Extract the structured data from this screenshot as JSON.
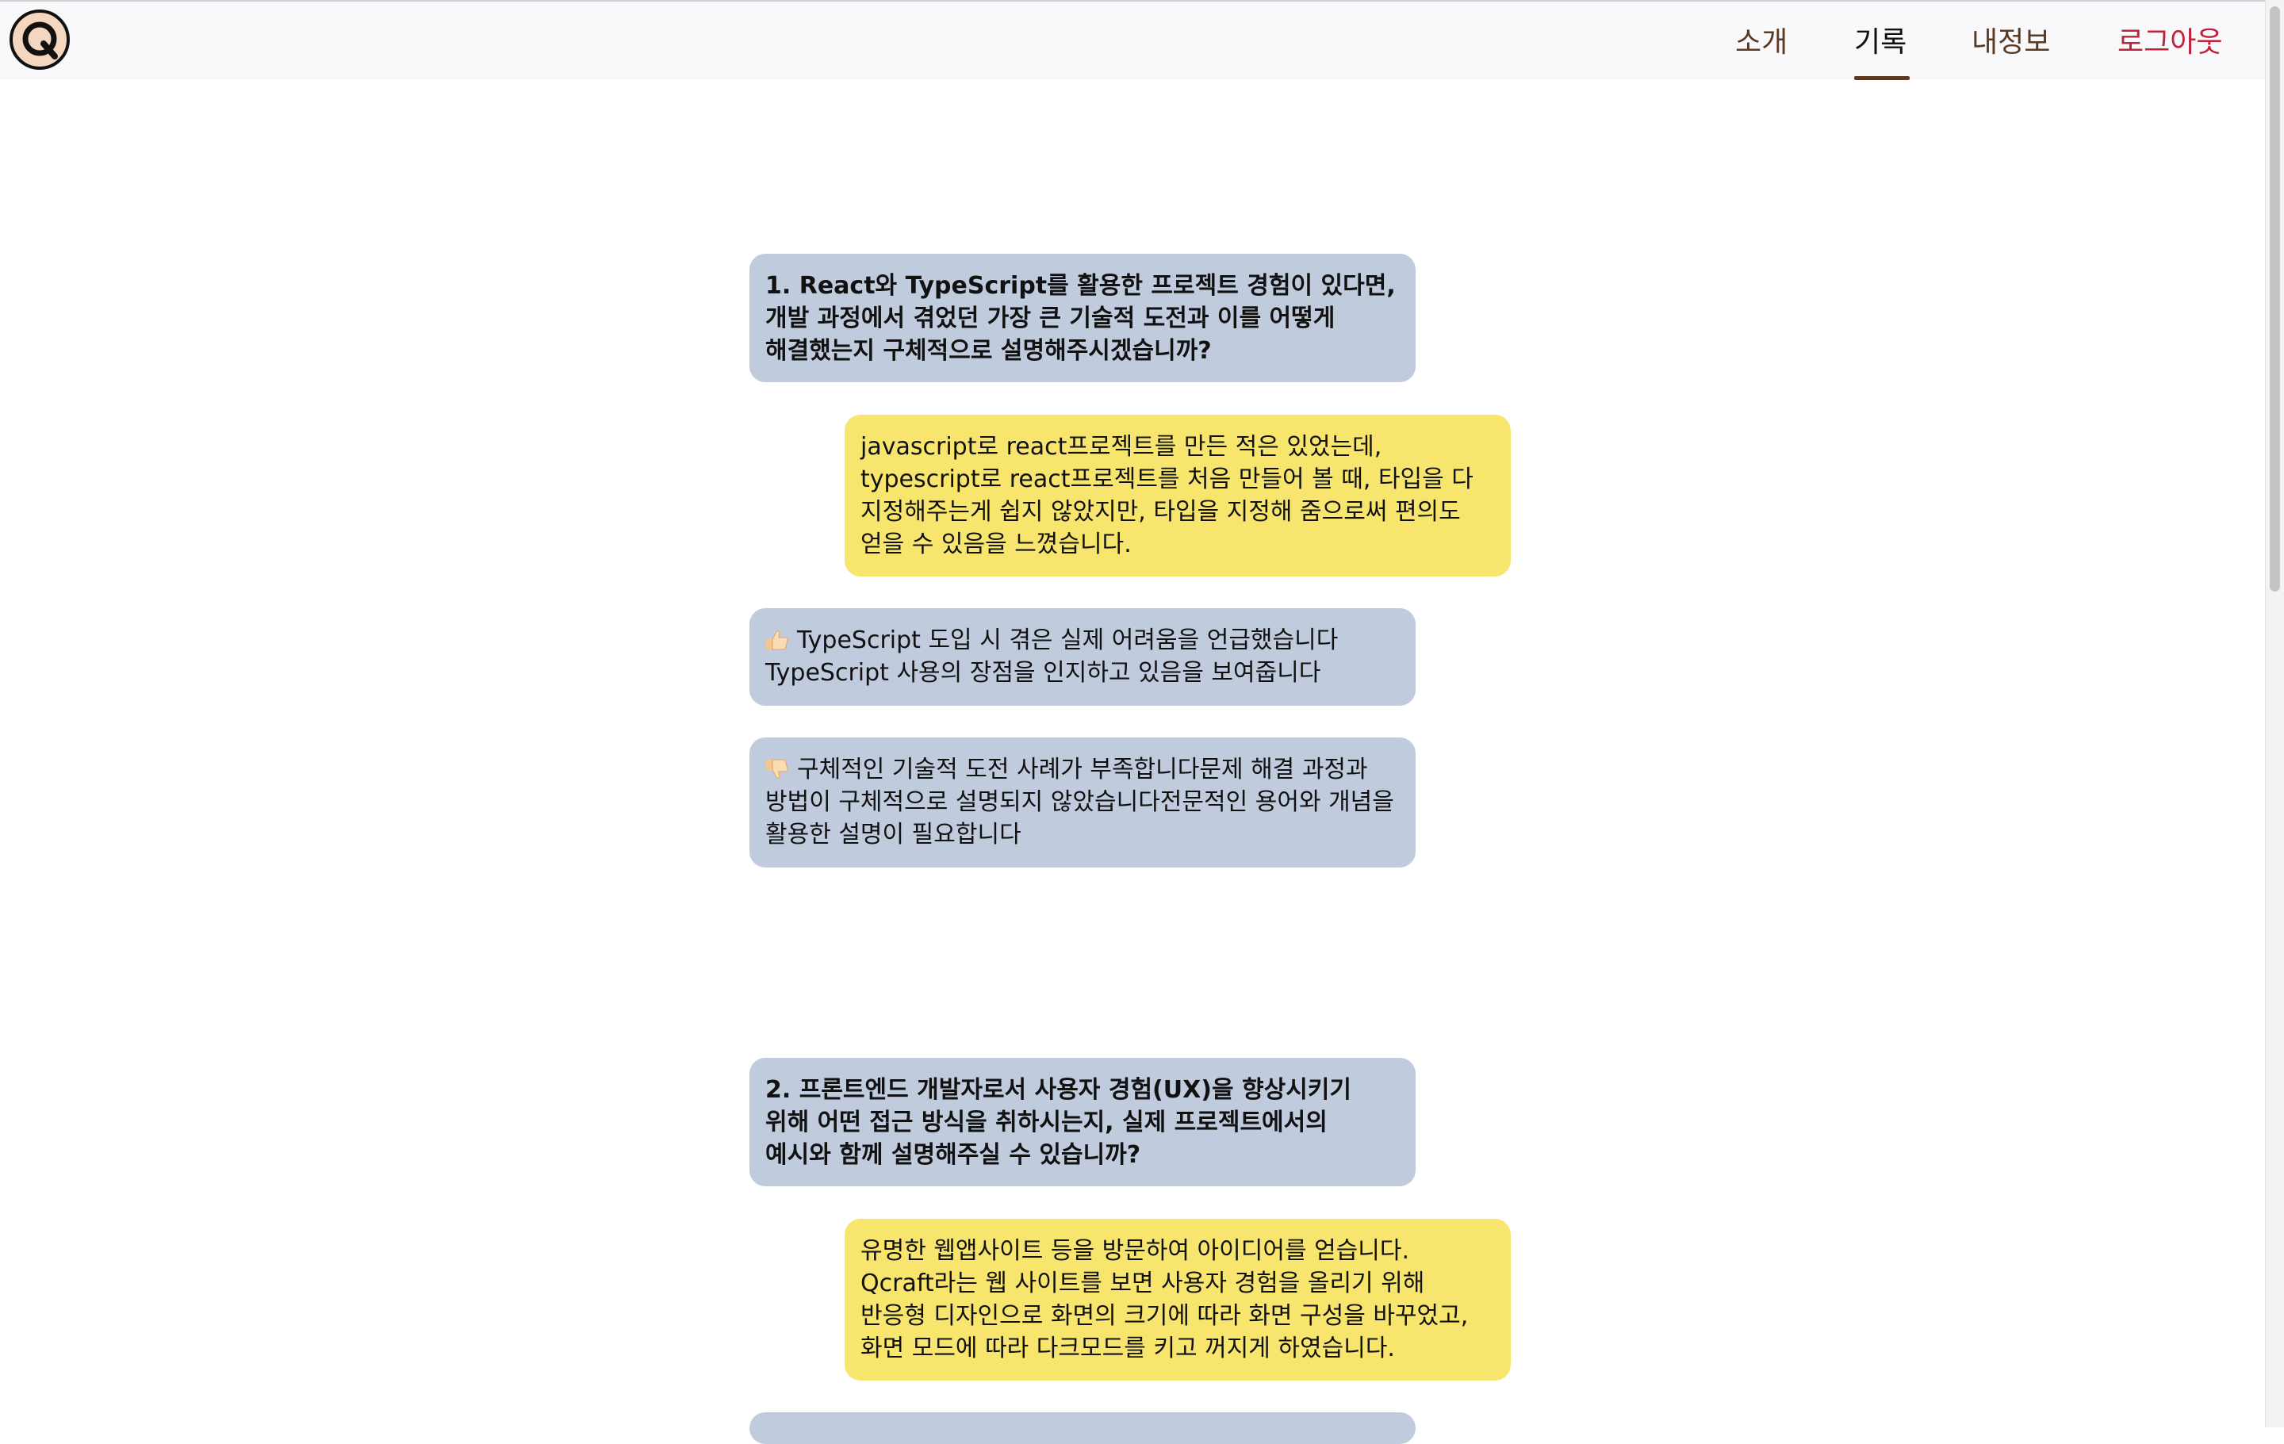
{
  "header": {
    "logo_letter": "Q",
    "nav": [
      {
        "label": "소개"
      },
      {
        "label": "기록"
      },
      {
        "label": "내정보"
      },
      {
        "label": "로그아웃"
      }
    ],
    "active_tab": "기록",
    "colors": {
      "nav_text": "#5b3a21",
      "logout_text": "#c0213a",
      "question_bubble": "#c0cbdd",
      "answer_bubble": "#f7e56e"
    }
  },
  "records": [
    {
      "question": "1. React와 TypeScript를 활용한 프로젝트 경험이 있다면, 개발 과정에서 겪었던 가장 큰 기술적 도전과 이를 어떻게 해결했는지 구체적으로 설명해주시겠습니까?",
      "answer": "javascript로 react프로젝트를 만든 적은 있었는데, typescript로 react프로젝트를 처음 만들어 볼 때, 타입을 다 지정해주는게 쉽지 않았지만, 타입을 지정해 줌으로써 편의도 얻을 수 있음을 느꼈습니다.",
      "good_icon": "thumbs-up-icon",
      "good_line1": "TypeScript 도입 시 겪은 실제 어려움을 언급했습니다",
      "good_line2": "TypeScript 사용의 장점을 인지하고 있음을 보여줍니다",
      "bad_icon": "thumbs-down-icon",
      "bad": "구체적인 기술적 도전 사례가 부족합니다문제 해결 과정과 방법이 구체적으로 설명되지 않았습니다전문적인 용어와 개념을 활용한 설명이 필요합니다"
    },
    {
      "question": "2. 프론트엔드 개발자로서 사용자 경험(UX)을 향상시키기 위해 어떤 접근 방식을 취하시는지, 실제 프로젝트에서의 예시와 함께 설명해주실 수 있습니까?",
      "answer": "유명한 웹앱사이트 등을 방문하여 아이디어를 얻습니다. Qcraft라는 웹 사이트를 보면 사용자 경험을 올리기 위해 반응형 디자인으로 화면의 크기에 따라 화면 구성을 바꾸었고, 화면 모드에 따라 다크모드를 키고 꺼지게 하였습니다."
    }
  ]
}
